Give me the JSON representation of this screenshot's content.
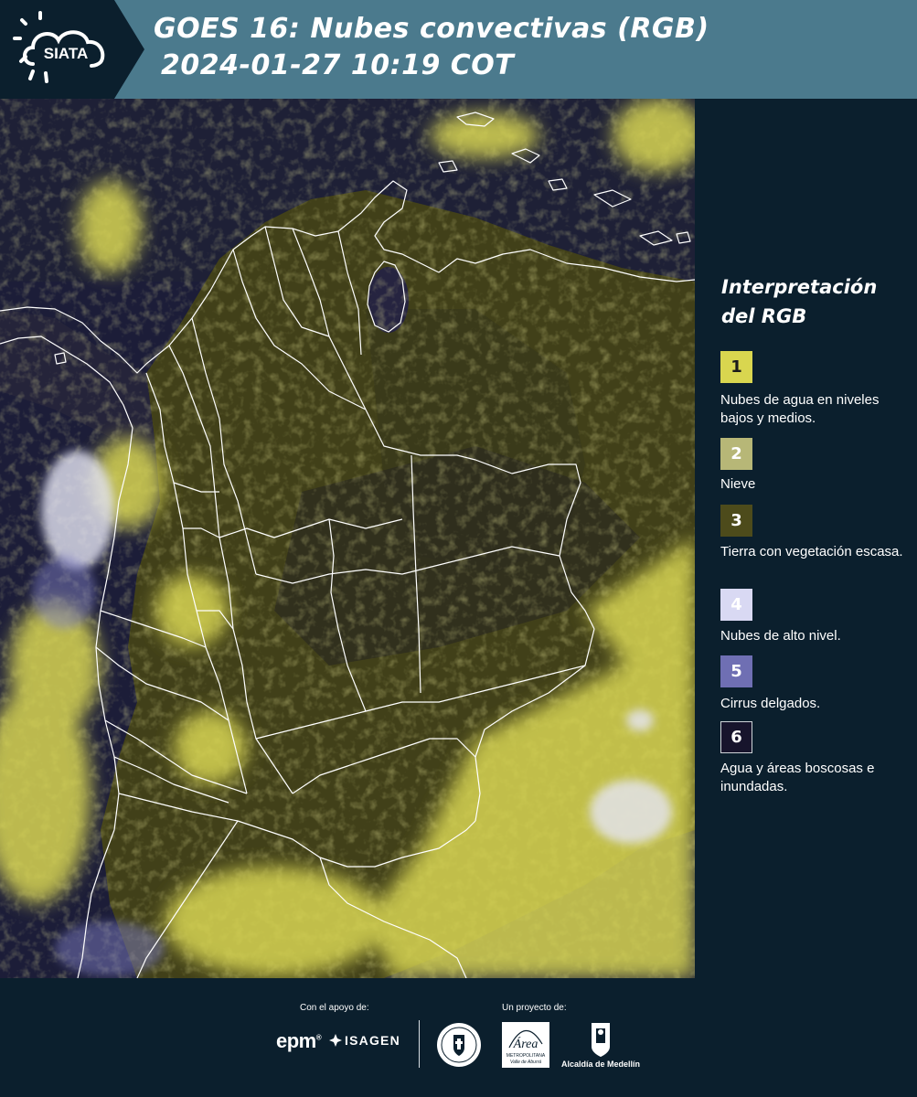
{
  "header": {
    "logo_text": "SIATA",
    "title_line1": "GOES 16: Nubes convectivas (RGB)",
    "title_line2": "2024-01-27 10:19 COT"
  },
  "legend": {
    "title": "Interpretación del RGB",
    "items": [
      {
        "number": "1",
        "label": "Nubes de agua en niveles bajos y medios.",
        "color": "#d9d64f",
        "text_color": "#1b1b1b"
      },
      {
        "number": "2",
        "label": "Nieve",
        "color": "#b7b777",
        "text_color": "#ffffff"
      },
      {
        "number": "3",
        "label": "Tierra con vegetación escasa.",
        "color": "#4d4b1b",
        "text_color": "#ffffff"
      },
      {
        "number": "4",
        "label": "Nubes de alto nivel.",
        "color": "#d9d9f3",
        "text_color": "#ffffff"
      },
      {
        "number": "5",
        "label": "Cirrus delgados.",
        "color": "#6f6fb3",
        "text_color": "#ffffff"
      },
      {
        "number": "6",
        "label": "Agua y áreas boscosas e inundadas.",
        "color": "#17142c",
        "text_color": "#ffffff"
      }
    ]
  },
  "footer": {
    "support_caption": "Con el apoyo de:",
    "project_caption": "Un proyecto de:",
    "sponsors": [
      "epm",
      "ISAGEN"
    ],
    "partners": {
      "area": "Área",
      "area_sub1": "METROPOLITANA",
      "area_sub2": "Valle de Aburrá",
      "alcaldia": "Alcaldía de Medellín"
    }
  },
  "colors": {
    "header_bg": "#4b7a8d",
    "dark_bg": "#0b1f2d",
    "cloud_yellow": "#e6e35a",
    "land_olive": "#4a4a1c",
    "ocean": "#1c1d38"
  }
}
